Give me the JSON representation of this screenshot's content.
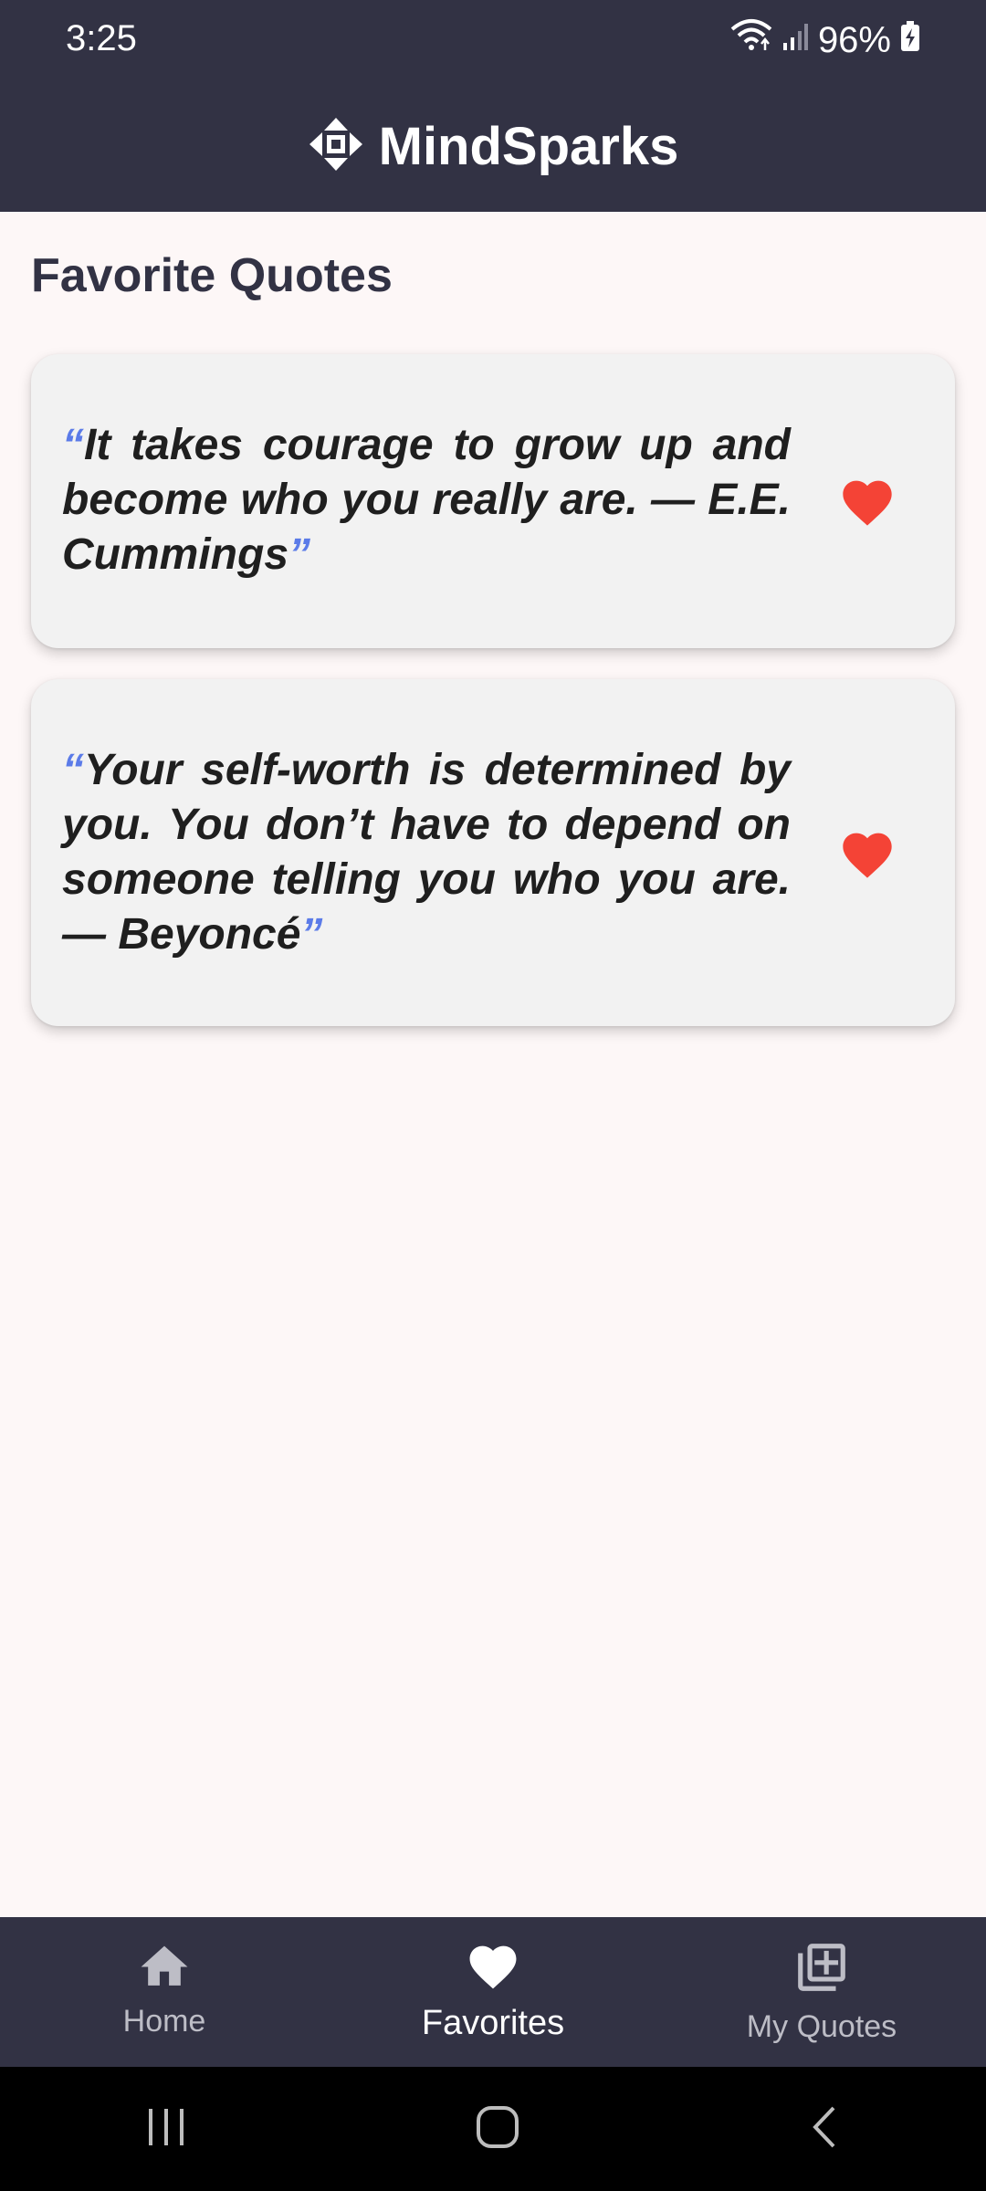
{
  "status": {
    "time": "3:25",
    "battery": "96%"
  },
  "app": {
    "title": "MindSparks"
  },
  "page": {
    "title": "Favorite Quotes"
  },
  "quotes": [
    {
      "open_mark": "“",
      "text": "It takes courage to grow up and become who you really are. — E.E. Cummings",
      "close_mark": "”",
      "favorited": true
    },
    {
      "open_mark": "“",
      "text": "Your self-worth is determined by you. You don’t have to depend on someone telling you who you are. — Beyoncé",
      "close_mark": "”",
      "favorited": true
    }
  ],
  "bottom_nav": {
    "items": [
      {
        "label": "Home",
        "icon": "home-icon",
        "active": false
      },
      {
        "label": "Favorites",
        "icon": "heart-icon",
        "active": true
      },
      {
        "label": "My Quotes",
        "icon": "library-add-icon",
        "active": false
      }
    ]
  },
  "colors": {
    "appbar": "#323244",
    "background": "#fdf7f7",
    "heart": "#f44336",
    "quote_mark": "#5b7be8"
  }
}
